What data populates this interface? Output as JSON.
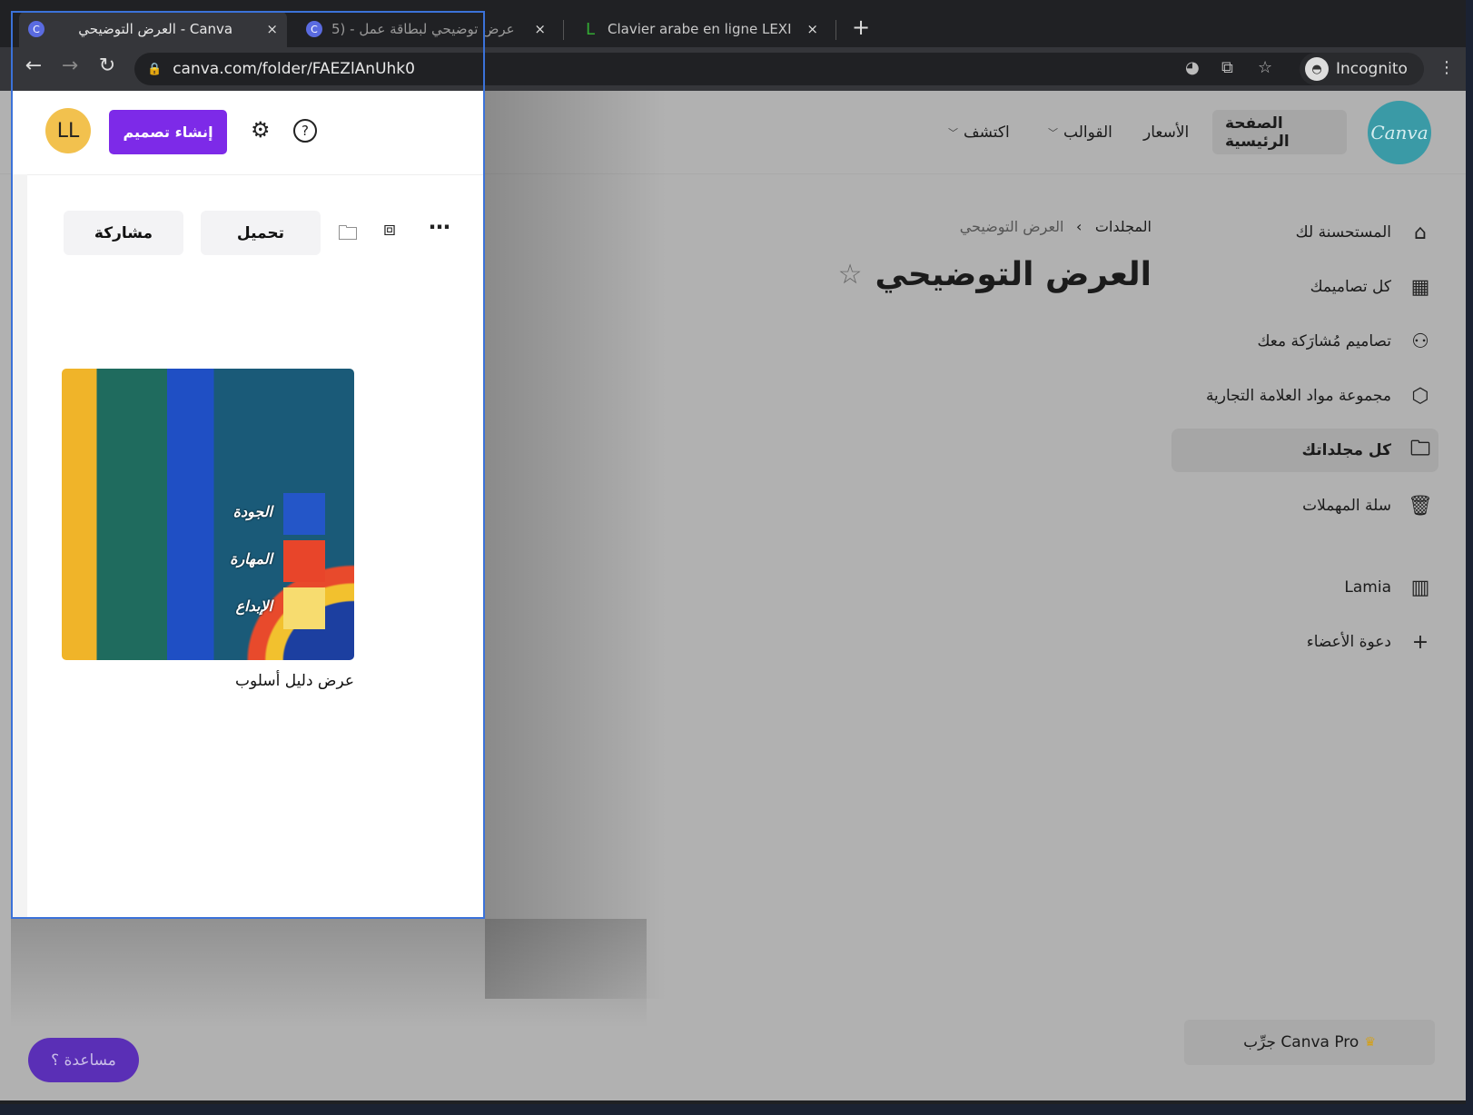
{
  "browser": {
    "tabs": [
      {
        "title": "العرض التوضيحي - Canva",
        "favicon": "C",
        "active": true
      },
      {
        "title": "عرض توضيحي لبطاقة عمل - (5",
        "favicon": "C",
        "active": false
      },
      {
        "title": "Clavier arabe en ligne LEXI",
        "favicon": "L",
        "active": false
      }
    ],
    "new_tab": "+",
    "close": "×",
    "url": "canva.com/folder/FAEZlAnUhk0",
    "incognito_label": "Incognito"
  },
  "header": {
    "logo": "Canva",
    "nav": [
      {
        "label": "الصفحة الرئيسية",
        "active": true
      },
      {
        "label": "الأسعار"
      },
      {
        "label": "القوالب",
        "dropdown": true
      },
      {
        "label": "اكتشف",
        "dropdown": true
      }
    ]
  },
  "sidebar": {
    "items": [
      {
        "label": "المستحسنة لك",
        "icon": "home-icon",
        "glyph": "⌂"
      },
      {
        "label": "كل تصاميمك",
        "icon": "grid-icon",
        "glyph": "▦"
      },
      {
        "label": "تصاميم مُشارَكة معك",
        "icon": "shared-users-icon",
        "glyph": "⚇"
      },
      {
        "label": "مجموعة مواد العلامة التجارية",
        "icon": "brand-kit-icon",
        "glyph": "⬡"
      },
      {
        "label": "كل مجلداتك",
        "icon": "folder-icon",
        "glyph": "🗀",
        "active": true
      },
      {
        "label": "سلة المهملات",
        "icon": "trash-icon",
        "glyph": "🗑"
      },
      {
        "label": "Lamia",
        "icon": "building-icon",
        "glyph": "▥"
      },
      {
        "label": "دعوة الأعضاء",
        "icon": "plus-icon",
        "glyph": "+"
      }
    ]
  },
  "main": {
    "breadcrumb": [
      "المجلدات",
      "العرض التوضيحي"
    ],
    "breadcrumb_sep": "›",
    "title": "العرض التوضيحي",
    "try_pro": "جرِّب Canva Pro",
    "help": "مساعدة ؟"
  },
  "popup": {
    "avatar": "LL",
    "create_design": "إنشاء تصميم",
    "share": "مشاركة",
    "download": "تحميل",
    "design": {
      "caption": "عرض دليل أسلوب",
      "labels": [
        "الجودة",
        "المهارة",
        "الإبداع"
      ],
      "swatches": [
        "#2456c8",
        "#e8452a",
        "#f7dc6f"
      ]
    }
  }
}
